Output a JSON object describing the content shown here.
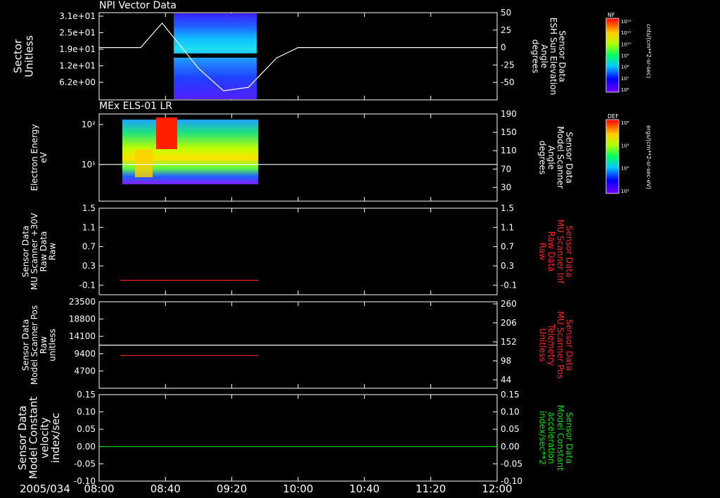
{
  "time_axis": {
    "date_label": "2005/034",
    "ticks": [
      "08:00",
      "08:40",
      "09:20",
      "10:00",
      "10:40",
      "11:20",
      "12:00"
    ]
  },
  "chart_data": [
    {
      "id": "npi",
      "type": "heatmap",
      "title": "NPI Vector Data",
      "ylabel": "Sector\nUnitless",
      "yticks": [
        "3.1e+01",
        "2.5e+01",
        "1.9e+01",
        "1.2e+01",
        "6.2e+00"
      ],
      "ylabel_right": "Sensor Data\nESH Sun Elevation\nAngle\ndegrees",
      "yticks_right": [
        "50",
        "25",
        "0",
        "-25",
        "-50"
      ],
      "ylim_right": [
        -75,
        50
      ],
      "data_time_range": [
        "08:45",
        "09:35"
      ],
      "line": {
        "color": "#ffffff",
        "points": [
          [
            "08:00",
            0
          ],
          [
            "08:25",
            0
          ],
          [
            "08:38",
            35
          ],
          [
            "09:00",
            -30
          ],
          [
            "09:15",
            -62
          ],
          [
            "09:30",
            -57
          ],
          [
            "09:47",
            -15
          ],
          [
            "10:00",
            0
          ],
          [
            "12:00",
            0
          ]
        ]
      },
      "colorbar": {
        "label": "NF",
        "unit": "cnts/(cm**2-sr-sec)",
        "ticks": [
          "10¹²",
          "10¹¹",
          "10¹⁰",
          "10⁹",
          "10⁸",
          "10⁷",
          "10⁶"
        ]
      }
    },
    {
      "id": "els",
      "type": "heatmap",
      "title": "MEx ELS-01 LR",
      "ylabel": "Electron Energy\neV",
      "yticks": [
        "10²",
        "10¹"
      ],
      "ylabel_right": "Sensor Data\nModel Scanner\nAngle\ndegrees",
      "yticks_right": [
        "190",
        "150",
        "110",
        "70",
        "30"
      ],
      "ylim_right": [
        0,
        190
      ],
      "data_time_range": [
        "08:14",
        "09:36"
      ],
      "line": {
        "color": "#ffffff",
        "points": [
          [
            "08:00",
            80
          ],
          [
            "12:00",
            80
          ]
        ]
      },
      "colorbar": {
        "label": "DEF",
        "unit": "ergs/(cm**2-sr-sec-eV)",
        "ticks": [
          "10⁴",
          "10³",
          "10²",
          "10¹"
        ]
      }
    },
    {
      "id": "raw30",
      "type": "line",
      "ylabel": "Sensor Data\nMU Scanner +30V\nRaw Data\nRaw",
      "yticks": [
        "1.5",
        "1.1",
        "0.7",
        "0.3",
        "-0.1"
      ],
      "ylim": [
        -0.3,
        1.5
      ],
      "ylabel_right": "Sensor Data\nMU Scanner Inf\nRaw Data\nRaw",
      "yticks_right": [
        "1.5",
        "1.1",
        "0.7",
        "0.3",
        "-0.1"
      ],
      "right_color": "#ff2020",
      "series": [
        {
          "color": "#ff2020",
          "points": [
            [
              "08:13",
              0.0
            ],
            [
              "09:36",
              0.0
            ]
          ]
        }
      ]
    },
    {
      "id": "pos",
      "type": "line",
      "ylabel": "Sensor Data\nModel Scanner Pos\nRaw\nunitless",
      "yticks": [
        "23500",
        "18800",
        "14100",
        "9400",
        "4700"
      ],
      "ylim": [
        0,
        23500
      ],
      "ylabel_right": "Sensor Data\nMU Scanner Pos\nTelemetry\nUnitless",
      "yticks_right": [
        "260",
        "206",
        "152",
        "98",
        "44"
      ],
      "right_color": "#ff2020",
      "series": [
        {
          "color": "#ffffff",
          "points": [
            [
              "08:00",
              11700
            ],
            [
              "12:00",
              11700
            ]
          ]
        },
        {
          "color": "#ff2020",
          "points": [
            [
              "08:13",
              8900
            ],
            [
              "09:36",
              8900
            ]
          ]
        }
      ]
    },
    {
      "id": "vel",
      "type": "line",
      "ylabel": "Sensor Data\nModel Constant\nvelocity\nindex/sec",
      "yticks": [
        "0.15",
        "0.10",
        "0.05",
        "0.00",
        "-0.05",
        "-0.10"
      ],
      "ylim": [
        -0.1,
        0.15
      ],
      "ylabel_right": "Sensor Data\nModel Constant\nacceleration\nindex/sec**2",
      "yticks_right": [
        "0.15",
        "0.10",
        "0.05",
        "0.00",
        "-0.05",
        "-0.10"
      ],
      "right_color": "#00e000",
      "series": [
        {
          "color": "#00e000",
          "points": [
            [
              "08:00",
              0.0
            ],
            [
              "12:00",
              0.0
            ]
          ]
        }
      ]
    }
  ]
}
